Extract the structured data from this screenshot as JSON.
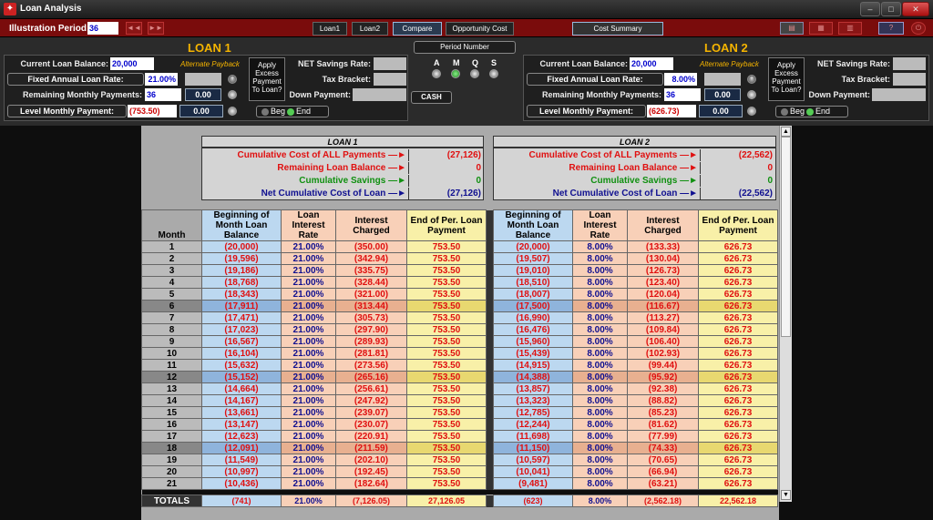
{
  "window": {
    "title": "Loan Analysis",
    "controls": [
      "–",
      "□",
      "✕"
    ]
  },
  "toolbar": {
    "illustration_label": "Illustration Period:",
    "illustration_value": "36",
    "tabs": [
      "Loan1",
      "Loan2",
      "Compare",
      "Opportunity Cost"
    ],
    "cost_summary": "Cost Summary"
  },
  "loan1": {
    "title": "LOAN 1",
    "current_balance_label": "Current Loan Balance:",
    "current_balance": "20,000",
    "rate_label": "Fixed Annual Loan Rate:",
    "rate": "21.00%",
    "remaining_label": "Remaining  Monthly Payments:",
    "remaining": "36",
    "remaining_extra": "0.00",
    "payment_label": "Level Monthly Payment:",
    "payment": "(753.50)",
    "payment_extra": "0.00",
    "alt_payback": "Alternate Payback",
    "apply_excess": "Apply Excess Payment To Loan?",
    "net_savings_label": "NET Savings Rate:",
    "tax_bracket_label": "Tax Bracket:",
    "down_payment_label": "Down Payment:",
    "beg": "Beg",
    "end": "End"
  },
  "loan2": {
    "title": "LOAN 2",
    "current_balance_label": "Current Loan Balance:",
    "current_balance": "20,000",
    "rate_label": "Fixed Annual Loan Rate:",
    "rate": "8.00%",
    "remaining_label": "Remaining  Monthly Payments:",
    "remaining": "36",
    "remaining_extra": "0.00",
    "payment_label": "Level Monthly Payment:",
    "payment": "(626.73)",
    "payment_extra": "0.00",
    "alt_payback": "Alternate Payback",
    "apply_excess": "Apply Excess Payment To Loan?",
    "net_savings_label": "NET Savings Rate:",
    "tax_bracket_label": "Tax Bracket:",
    "down_payment_label": "Down Payment:",
    "beg": "Beg",
    "end": "End"
  },
  "period": {
    "label": "Period Number",
    "options": [
      "A",
      "M",
      "Q",
      "S"
    ],
    "cash": "CASH"
  },
  "summary": {
    "loan1": {
      "title": "LOAN 1",
      "lines": [
        {
          "label": "Cumulative Cost of ALL Payments —►",
          "value": "(27,126)",
          "color": "#e01010"
        },
        {
          "label": "Remaining Loan Balance —►",
          "value": "0",
          "color": "#e01010"
        },
        {
          "label": "Cumulative Savings —►",
          "value": "0",
          "color": "#109010"
        },
        {
          "label": "Net Cumulative Cost of Loan —►",
          "value": "(27,126)",
          "color": "#101090"
        }
      ]
    },
    "loan2": {
      "title": "LOAN 2",
      "lines": [
        {
          "label": "Cumulative Cost of ALL Payments —►",
          "value": "(22,562)",
          "color": "#e01010"
        },
        {
          "label": "Remaining Loan Balance —►",
          "value": "0",
          "color": "#e01010"
        },
        {
          "label": "Cumulative Savings —►",
          "value": "0",
          "color": "#109010"
        },
        {
          "label": "Net Cumulative Cost of Loan —►",
          "value": "(22,562)",
          "color": "#101090"
        }
      ]
    }
  },
  "table": {
    "month_header": "Month",
    "col_headers": [
      "Beginning of Month Loan Balance",
      "Loan Interest Rate",
      "Interest Charged",
      "End of Per. Loan Payment"
    ],
    "rows": [
      [
        "1",
        "(20,000)",
        "21.00%",
        "(350.00)",
        "753.50",
        "(20,000)",
        "8.00%",
        "(133.33)",
        "626.73"
      ],
      [
        "2",
        "(19,596)",
        "21.00%",
        "(342.94)",
        "753.50",
        "(19,507)",
        "8.00%",
        "(130.04)",
        "626.73"
      ],
      [
        "3",
        "(19,186)",
        "21.00%",
        "(335.75)",
        "753.50",
        "(19,010)",
        "8.00%",
        "(126.73)",
        "626.73"
      ],
      [
        "4",
        "(18,768)",
        "21.00%",
        "(328.44)",
        "753.50",
        "(18,510)",
        "8.00%",
        "(123.40)",
        "626.73"
      ],
      [
        "5",
        "(18,343)",
        "21.00%",
        "(321.00)",
        "753.50",
        "(18,007)",
        "8.00%",
        "(120.04)",
        "626.73"
      ],
      [
        "6",
        "(17,911)",
        "21.00%",
        "(313.44)",
        "753.50",
        "(17,500)",
        "8.00%",
        "(116.67)",
        "626.73"
      ],
      [
        "7",
        "(17,471)",
        "21.00%",
        "(305.73)",
        "753.50",
        "(16,990)",
        "8.00%",
        "(113.27)",
        "626.73"
      ],
      [
        "8",
        "(17,023)",
        "21.00%",
        "(297.90)",
        "753.50",
        "(16,476)",
        "8.00%",
        "(109.84)",
        "626.73"
      ],
      [
        "9",
        "(16,567)",
        "21.00%",
        "(289.93)",
        "753.50",
        "(15,960)",
        "8.00%",
        "(106.40)",
        "626.73"
      ],
      [
        "10",
        "(16,104)",
        "21.00%",
        "(281.81)",
        "753.50",
        "(15,439)",
        "8.00%",
        "(102.93)",
        "626.73"
      ],
      [
        "11",
        "(15,632)",
        "21.00%",
        "(273.56)",
        "753.50",
        "(14,915)",
        "8.00%",
        "(99.44)",
        "626.73"
      ],
      [
        "12",
        "(15,152)",
        "21.00%",
        "(265.16)",
        "753.50",
        "(14,388)",
        "8.00%",
        "(95.92)",
        "626.73"
      ],
      [
        "13",
        "(14,664)",
        "21.00%",
        "(256.61)",
        "753.50",
        "(13,857)",
        "8.00%",
        "(92.38)",
        "626.73"
      ],
      [
        "14",
        "(14,167)",
        "21.00%",
        "(247.92)",
        "753.50",
        "(13,323)",
        "8.00%",
        "(88.82)",
        "626.73"
      ],
      [
        "15",
        "(13,661)",
        "21.00%",
        "(239.07)",
        "753.50",
        "(12,785)",
        "8.00%",
        "(85.23)",
        "626.73"
      ],
      [
        "16",
        "(13,147)",
        "21.00%",
        "(230.07)",
        "753.50",
        "(12,244)",
        "8.00%",
        "(81.62)",
        "626.73"
      ],
      [
        "17",
        "(12,623)",
        "21.00%",
        "(220.91)",
        "753.50",
        "(11,698)",
        "8.00%",
        "(77.99)",
        "626.73"
      ],
      [
        "18",
        "(12,091)",
        "21.00%",
        "(211.59)",
        "753.50",
        "(11,150)",
        "8.00%",
        "(74.33)",
        "626.73"
      ],
      [
        "19",
        "(11,549)",
        "21.00%",
        "(202.10)",
        "753.50",
        "(10,597)",
        "8.00%",
        "(70.65)",
        "626.73"
      ],
      [
        "20",
        "(10,997)",
        "21.00%",
        "(192.45)",
        "753.50",
        "(10,041)",
        "8.00%",
        "(66.94)",
        "626.73"
      ],
      [
        "21",
        "(10,436)",
        "21.00%",
        "(182.64)",
        "753.50",
        "(9,481)",
        "8.00%",
        "(63.21)",
        "626.73"
      ]
    ],
    "totals": [
      "TOTALS",
      "(741)",
      "21.00%",
      "(7,126.05)",
      "27,126.05",
      "(623)",
      "8.00%",
      "(2,562.18)",
      "22,562.18"
    ]
  },
  "colors": {
    "balance": "#bcd8f0",
    "rate": "#f8d0b8",
    "interest": "#f8d0b8",
    "payment": "#f8f0a8",
    "highlight_balance": "#8fb4dc",
    "highlight_other": "#e8b090",
    "highlight_pay": "#e8d870"
  }
}
